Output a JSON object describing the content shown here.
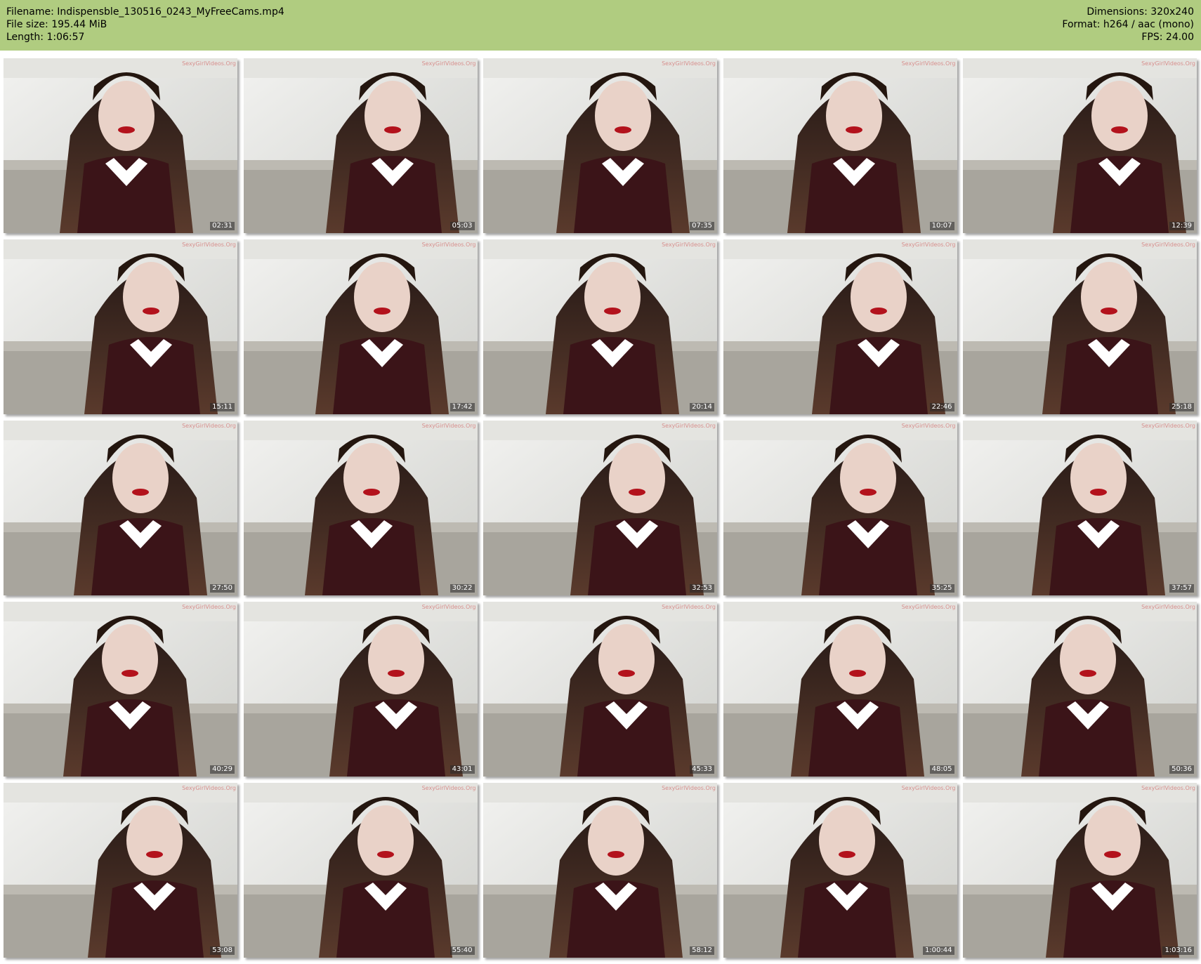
{
  "header": {
    "filename": "Filename: Indispensble_130516_0243_MyFreeCams.mp4",
    "filesize": "File size: 195.44 MiB",
    "length": "Length: 1:06:57",
    "dimensions": "Dimensions: 320x240",
    "format": "Format: h264 / aac (mono)",
    "fps": "FPS: 24.00",
    "background_color": "#b0cc80"
  },
  "watermark": "SexyGirlVideos.Org",
  "thumbnails": [
    {
      "timestamp": "02:31"
    },
    {
      "timestamp": "05:03"
    },
    {
      "timestamp": "07:35"
    },
    {
      "timestamp": "10:07"
    },
    {
      "timestamp": "12:39"
    },
    {
      "timestamp": "15:11"
    },
    {
      "timestamp": "17:42"
    },
    {
      "timestamp": "20:14"
    },
    {
      "timestamp": "22:46"
    },
    {
      "timestamp": "25:18"
    },
    {
      "timestamp": "27:50"
    },
    {
      "timestamp": "30:22"
    },
    {
      "timestamp": "32:53"
    },
    {
      "timestamp": "35:25"
    },
    {
      "timestamp": "37:57"
    },
    {
      "timestamp": "40:29"
    },
    {
      "timestamp": "43:01"
    },
    {
      "timestamp": "45:33"
    },
    {
      "timestamp": "48:05"
    },
    {
      "timestamp": "50:36"
    },
    {
      "timestamp": "53:08"
    },
    {
      "timestamp": "55:40"
    },
    {
      "timestamp": "58:12"
    },
    {
      "timestamp": "1:00:44"
    },
    {
      "timestamp": "1:03:16"
    }
  ]
}
